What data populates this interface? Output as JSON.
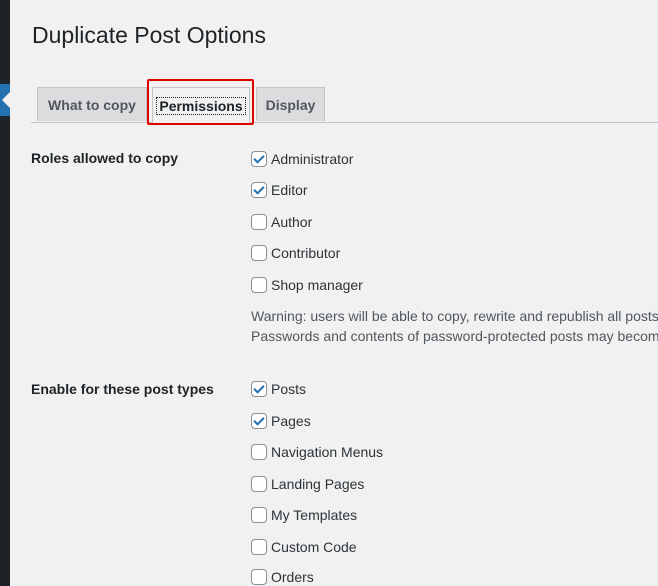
{
  "page": {
    "title": "Duplicate Post Options"
  },
  "tabs": [
    {
      "label": "What to copy",
      "active": false
    },
    {
      "label": "Permissions",
      "active": true
    },
    {
      "label": "Display",
      "active": false
    }
  ],
  "roles": {
    "label": "Roles allowed to copy",
    "options": [
      {
        "label": "Administrator",
        "checked": true
      },
      {
        "label": "Editor",
        "checked": true
      },
      {
        "label": "Author",
        "checked": false
      },
      {
        "label": "Contributor",
        "checked": false
      },
      {
        "label": "Shop manager",
        "checked": false
      }
    ],
    "warning_line1": "Warning: users will be able to copy, rewrite and republish all posts",
    "warning_line2": "Passwords and contents of password-protected posts may become"
  },
  "post_types": {
    "label": "Enable for these post types",
    "options": [
      {
        "label": "Posts",
        "checked": true
      },
      {
        "label": "Pages",
        "checked": true
      },
      {
        "label": "Navigation Menus",
        "checked": false
      },
      {
        "label": "Landing Pages",
        "checked": false
      },
      {
        "label": "My Templates",
        "checked": false
      },
      {
        "label": "Custom Code",
        "checked": false
      },
      {
        "label": "Orders",
        "checked": false
      }
    ]
  },
  "colors": {
    "highlight": "#e00000",
    "accent": "#2271b1"
  }
}
